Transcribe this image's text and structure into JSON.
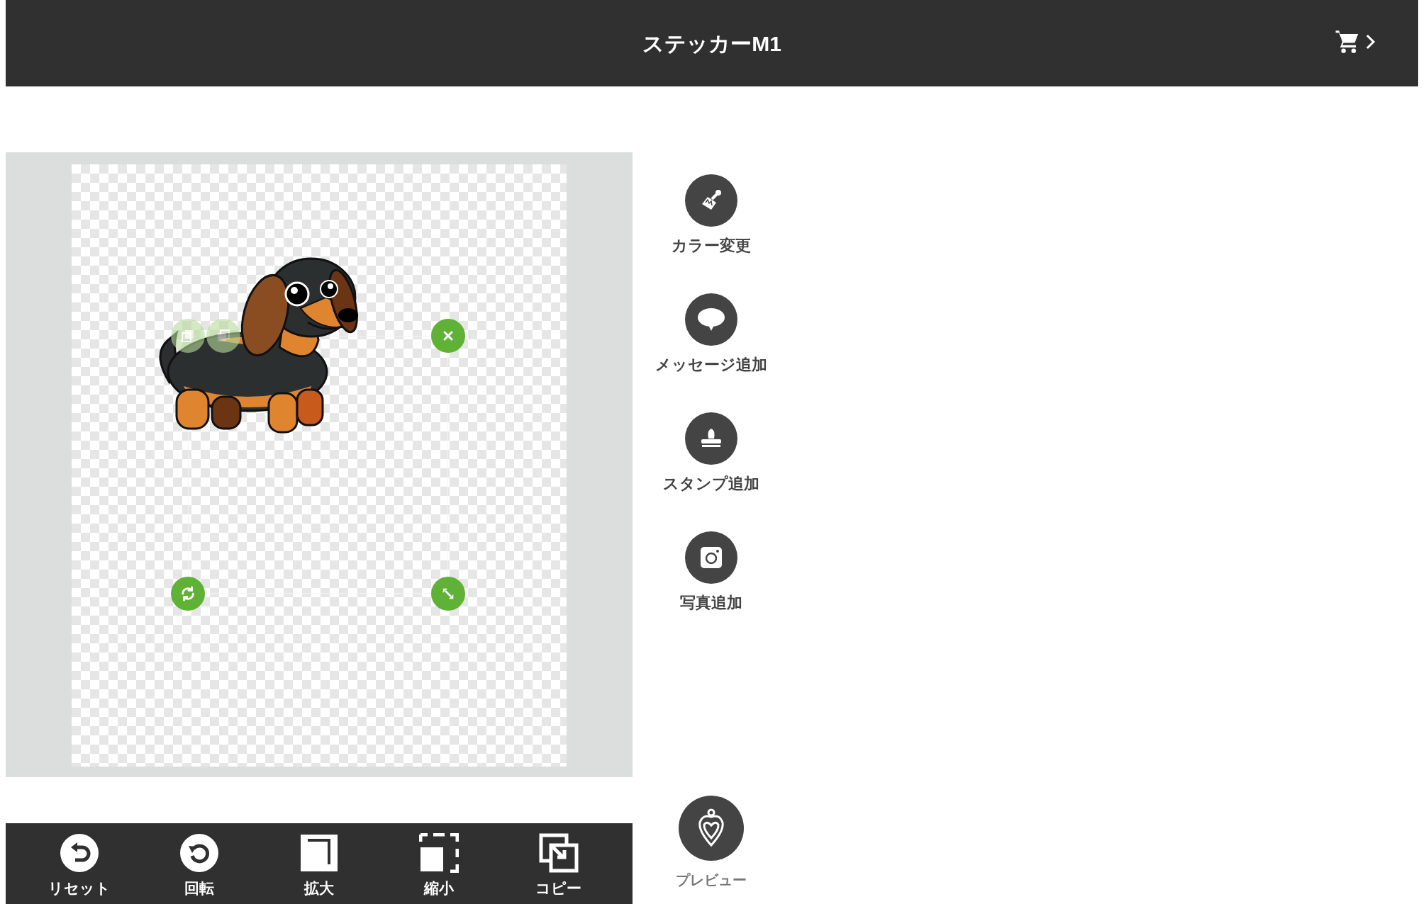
{
  "header": {
    "title": "ステッカーM1"
  },
  "canvas": {
    "handles": [
      {
        "kind": "layer-up",
        "disabled": true
      },
      {
        "kind": "layer-down",
        "disabled": true
      },
      {
        "kind": "delete",
        "disabled": false
      },
      {
        "kind": "rotate",
        "disabled": false
      },
      {
        "kind": "resize",
        "disabled": false
      }
    ]
  },
  "tools": [
    {
      "kind": "brush",
      "label": "カラー変更"
    },
    {
      "kind": "speech",
      "label": "メッセージ追加"
    },
    {
      "kind": "stamp",
      "label": "スタンプ追加"
    },
    {
      "kind": "camera",
      "label": "写真追加"
    }
  ],
  "toolbar": [
    {
      "kind": "reset",
      "label": "リセット"
    },
    {
      "kind": "rotate",
      "label": "回転"
    },
    {
      "kind": "enlarge",
      "label": "拡大"
    },
    {
      "kind": "shrink",
      "label": "縮小"
    },
    {
      "kind": "copy",
      "label": "コピー"
    }
  ],
  "preview": {
    "label": "プレビュー"
  }
}
